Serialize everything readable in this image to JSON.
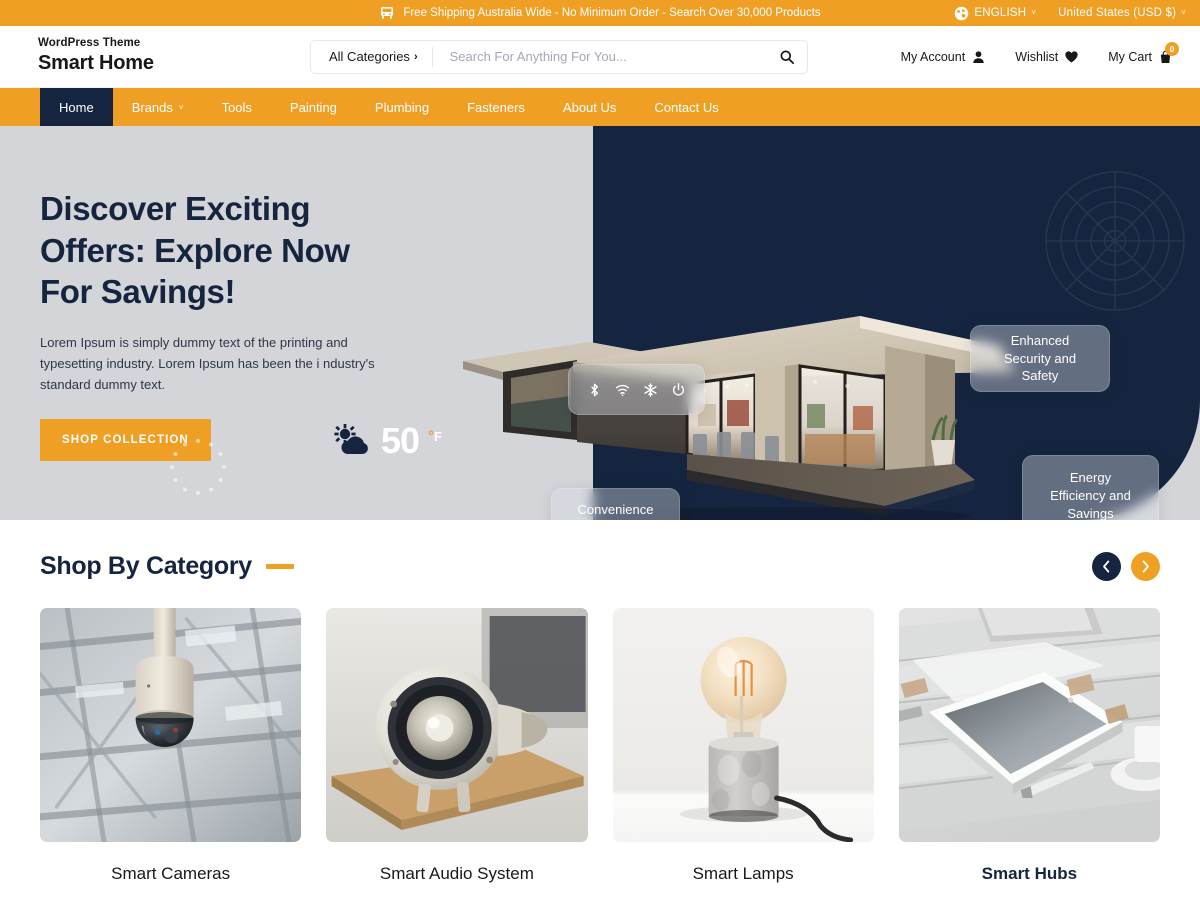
{
  "topbar": {
    "announcement": "Free Shipping Australia Wide - No Minimum Order - Search Over 30,000 Products",
    "shipping_icon": "truck-icon",
    "globe_icon": "globe-icon",
    "language": "ENGLISH",
    "currency": "United States (USD $)",
    "caret": "˅",
    "bg_color": "#efa024"
  },
  "header": {
    "logo_top": "WordPress Theme",
    "logo_main": "Smart Home",
    "categories_label": "All Categories",
    "categories_chevron": "›",
    "search_placeholder": "Search For Anything For You...",
    "search_value": "",
    "search_icon": "search-icon",
    "actions": [
      {
        "label": "My Account",
        "icon": "user-icon"
      },
      {
        "label": "Wishlist",
        "icon": "heart-icon"
      },
      {
        "label": "My Cart",
        "icon": "shopping-bag-icon",
        "badge": "0"
      }
    ]
  },
  "nav": {
    "items": [
      {
        "label": "Home",
        "active": true,
        "dropdown": false
      },
      {
        "label": "Brands",
        "active": false,
        "dropdown": true
      },
      {
        "label": "Tools",
        "active": false,
        "dropdown": false
      },
      {
        "label": "Painting",
        "active": false,
        "dropdown": false
      },
      {
        "label": "Plumbing",
        "active": false,
        "dropdown": false
      },
      {
        "label": "Fasteners",
        "active": false,
        "dropdown": false
      },
      {
        "label": "About Us",
        "active": false,
        "dropdown": false
      },
      {
        "label": "Contact Us",
        "active": false,
        "dropdown": false
      }
    ],
    "dropdown_caret": "˅",
    "bg_color": "#efa024",
    "active_color": "#16253f"
  },
  "hero": {
    "title": "Discover Exciting\nOffers: Explore Now\nFor Savings!",
    "subtitle": "Lorem Ipsum is simply dummy text of the printing and typesetting industry. Lorem Ipsum has been the i ndustry's standard dummy text.",
    "cta_label": "SHOP COLLECTION",
    "weather": {
      "icon": "sun-behind-cloud-icon",
      "temperature": "50",
      "degree_symbol": "°",
      "unit": "F"
    },
    "device_icons": [
      "bluetooth-icon",
      "wifi-icon",
      "snowflake-icon",
      "power-icon"
    ],
    "badges": [
      {
        "name": "security-badge",
        "text": "Enhanced\nSecurity and\nSafety"
      },
      {
        "name": "convenience-badge",
        "text": "Convenience\nand Comfort"
      },
      {
        "name": "energy-badge",
        "text": "Energy\nEfficiency and\nSavings"
      }
    ],
    "bg_light": "#d4d5d9",
    "bg_dark": "#16253f"
  },
  "category_section": {
    "title": "Shop By Category",
    "prev_label": "‹",
    "next_label": "›",
    "cards": [
      {
        "label": "Smart Cameras",
        "image": "dome-security-camera-photo",
        "highlighted": false
      },
      {
        "label": "Smart Audio System",
        "image": "vintage-speaker-photo",
        "highlighted": false
      },
      {
        "label": "Smart Lamps",
        "image": "edison-bulb-lamp-photo",
        "highlighted": false
      },
      {
        "label": "Smart Hubs",
        "image": "tablet-on-wooden-desk-photo",
        "highlighted": true
      }
    ]
  }
}
